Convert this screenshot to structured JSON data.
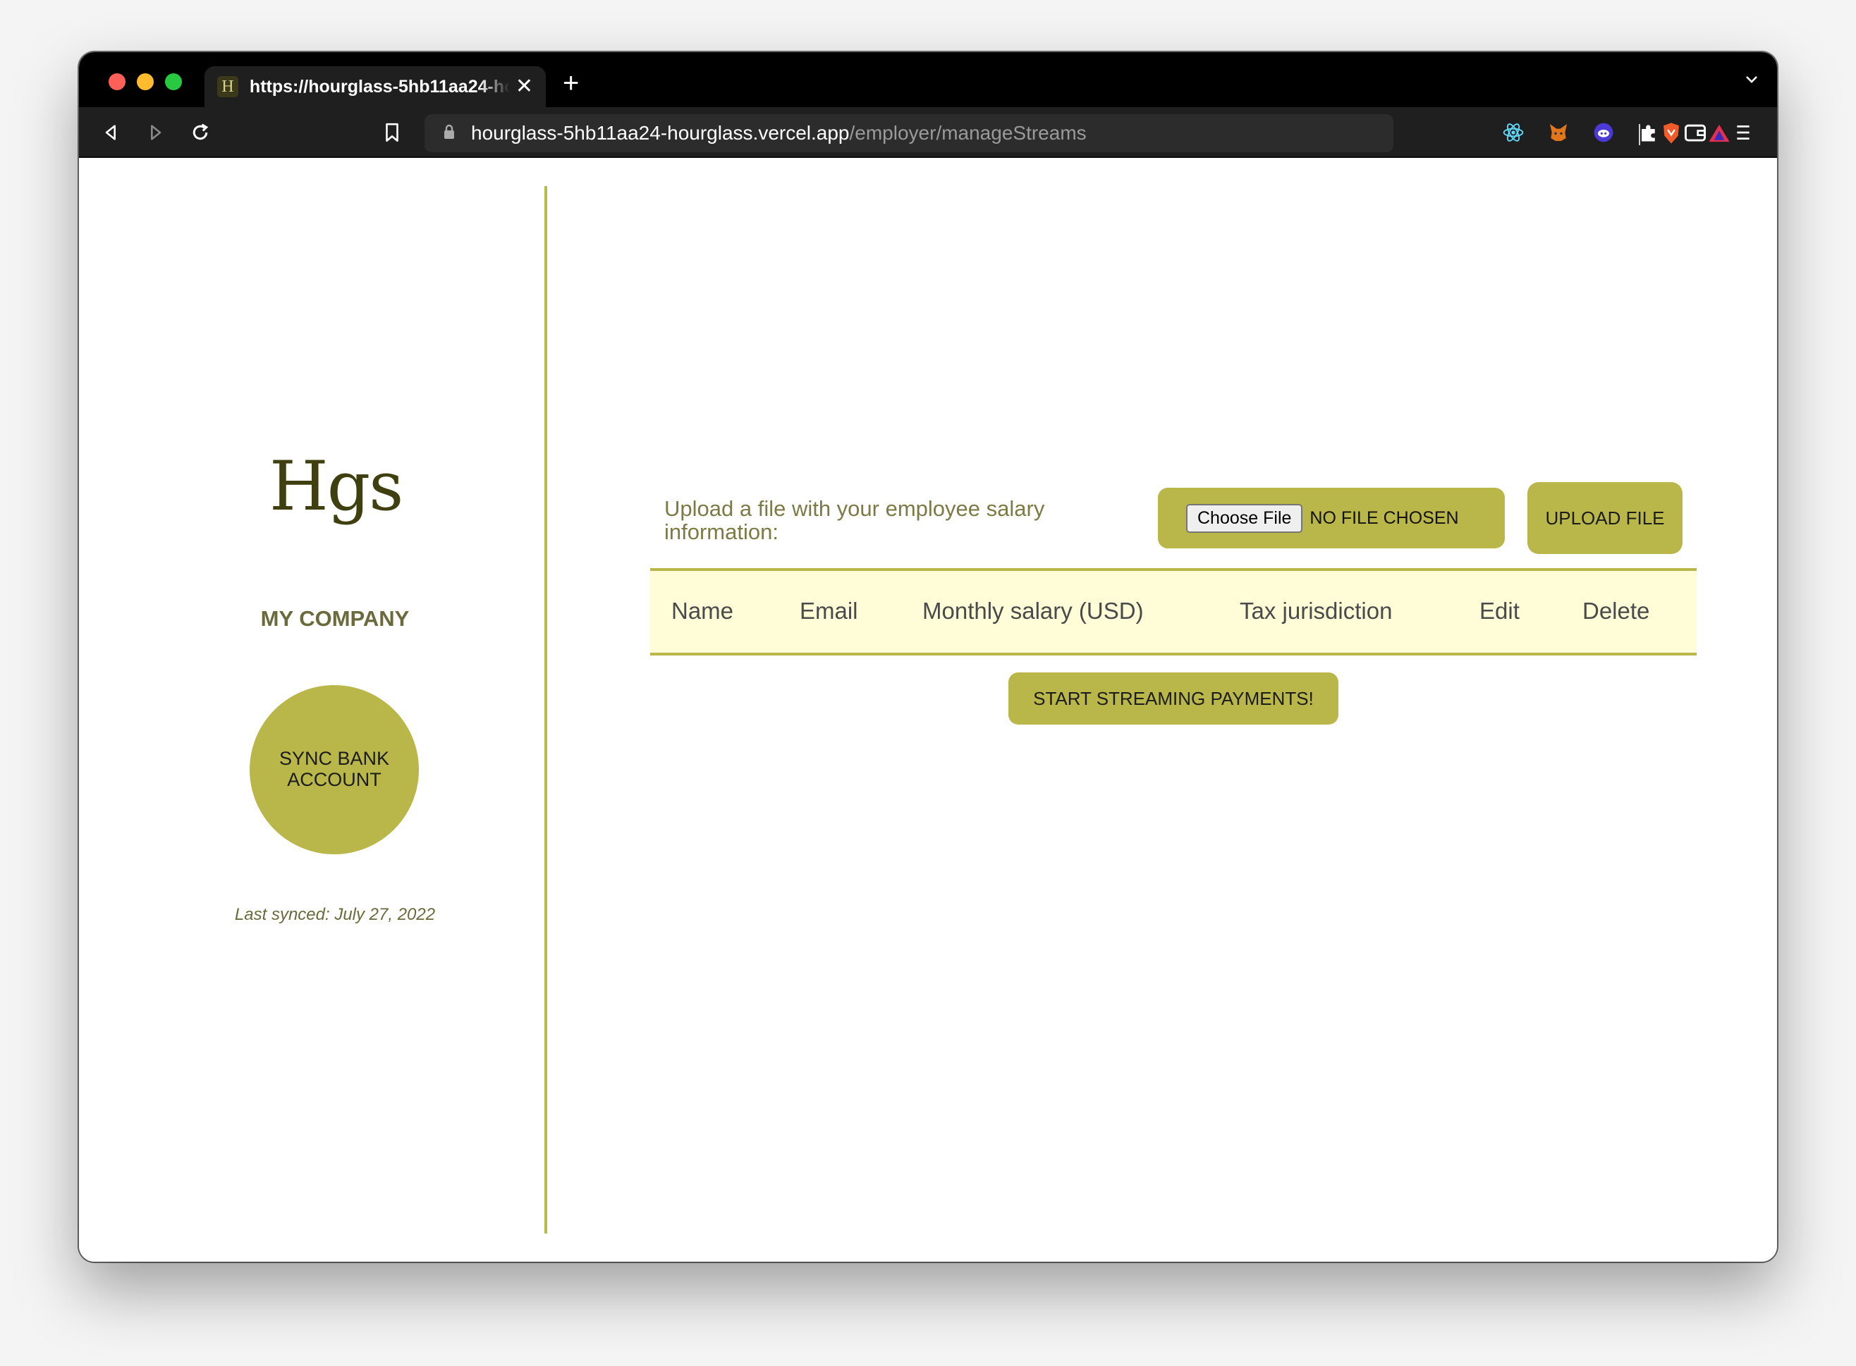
{
  "browser": {
    "tab_title": "https://hourglass-5hb11aa24-hourglass.vercel.app/employer/manageStreams",
    "tab_favicon_text": "H",
    "url_host": "hourglass-5hb11aa24-hourglass.vercel.app",
    "url_path": "/employer/manageStreams",
    "icons": [
      "back-icon",
      "forward-icon",
      "reload-icon",
      "bookmark-icon",
      "lock-icon",
      "brave-shield-icon",
      "brave-rewards-icon",
      "react-devtools-icon",
      "metamask-icon",
      "extension-icon",
      "extensions-puzzle-icon",
      "wallet-icon",
      "menu-icon"
    ]
  },
  "sidebar": {
    "logo": "Hgs",
    "company_name": "MY COMPANY",
    "sync_button": "SYNC BANK ACCOUNT",
    "last_synced": "Last synced: July 27, 2022"
  },
  "main": {
    "upload_label": "Upload a file with your employee salary information:",
    "choose_file_button": "Choose File",
    "no_file_text": "NO FILE CHOSEN",
    "upload_button": "UPLOAD FILE",
    "table_headers": [
      "Name",
      "Email",
      "Monthly salary (USD)",
      "Tax jurisdiction",
      "Edit",
      "Delete"
    ],
    "stream_button": "START STREAMING PAYMENTS!"
  },
  "colors": {
    "accent": "#b9b74a",
    "table_header_bg": "#fffdd8",
    "text_olive": "#6b6a3c"
  }
}
